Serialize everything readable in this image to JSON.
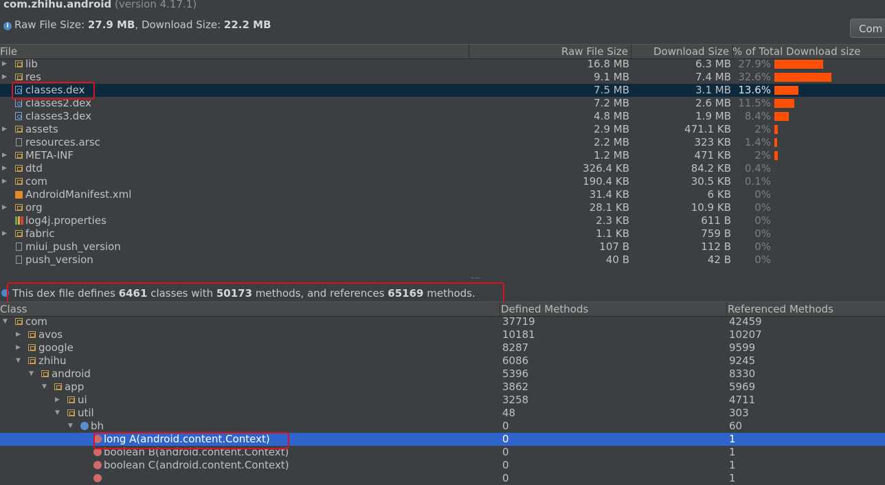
{
  "header": {
    "package": "com.zhihu.android",
    "version": "(version 4.17.1)",
    "raw_label": "Raw File Size:",
    "raw_value": "27.9 MB",
    "dl_label": ", Download Size:",
    "dl_value": "22.2 MB",
    "compare_button": "Com"
  },
  "file_table": {
    "columns": [
      "File",
      "Raw File Size",
      "Download Size",
      "% of Total Download size"
    ],
    "rows": [
      {
        "name": "lib",
        "icon": "folder-icon",
        "expandable": true,
        "raw": "16.8 MB",
        "dl": "6.3 MB",
        "pct": "27.9%",
        "share": 27.9
      },
      {
        "name": "res",
        "icon": "folder-icon",
        "expandable": true,
        "raw": "9.1 MB",
        "dl": "7.4 MB",
        "pct": "32.6%",
        "share": 32.6
      },
      {
        "name": "classes.dex",
        "icon": "dex-file-icon",
        "expandable": false,
        "raw": "7.5 MB",
        "dl": "3.1 MB",
        "pct": "13.6%",
        "share": 13.6,
        "selected": true
      },
      {
        "name": "classes2.dex",
        "icon": "dex-file-icon",
        "expandable": false,
        "raw": "7.2 MB",
        "dl": "2.6 MB",
        "pct": "11.5%",
        "share": 11.5
      },
      {
        "name": "classes3.dex",
        "icon": "dex-file-icon",
        "expandable": false,
        "raw": "4.8 MB",
        "dl": "1.9 MB",
        "pct": "8.4%",
        "share": 8.4
      },
      {
        "name": "assets",
        "icon": "folder-icon",
        "expandable": true,
        "raw": "2.9 MB",
        "dl": "471.1 KB",
        "pct": "2%",
        "share": 2
      },
      {
        "name": "resources.arsc",
        "icon": "file-icon",
        "expandable": false,
        "raw": "2.2 MB",
        "dl": "323 KB",
        "pct": "1.4%",
        "share": 1.4
      },
      {
        "name": "META-INF",
        "icon": "folder-icon",
        "expandable": true,
        "raw": "1.2 MB",
        "dl": "471 KB",
        "pct": "2%",
        "share": 2
      },
      {
        "name": "dtd",
        "icon": "folder-icon",
        "expandable": true,
        "raw": "326.4 KB",
        "dl": "84.2 KB",
        "pct": "0.4%",
        "share": 0
      },
      {
        "name": "com",
        "icon": "folder-icon",
        "expandable": true,
        "raw": "190.4 KB",
        "dl": "30.5 KB",
        "pct": "0.1%",
        "share": 0
      },
      {
        "name": "AndroidManifest.xml",
        "icon": "xml-file-icon",
        "expandable": false,
        "raw": "31.4 KB",
        "dl": "6 KB",
        "pct": "0%",
        "share": 0
      },
      {
        "name": "org",
        "icon": "folder-icon",
        "expandable": true,
        "raw": "28.1 KB",
        "dl": "10.9 KB",
        "pct": "0%",
        "share": 0
      },
      {
        "name": "log4j.properties",
        "icon": "properties-file-icon",
        "expandable": false,
        "raw": "2.3 KB",
        "dl": "611 B",
        "pct": "0%",
        "share": 0
      },
      {
        "name": "fabric",
        "icon": "folder-icon",
        "expandable": true,
        "raw": "1.1 KB",
        "dl": "759 B",
        "pct": "0%",
        "share": 0
      },
      {
        "name": "miui_push_version",
        "icon": "file-icon",
        "expandable": false,
        "raw": "107 B",
        "dl": "112 B",
        "pct": "0%",
        "share": 0
      },
      {
        "name": "push_version",
        "icon": "file-icon",
        "expandable": false,
        "raw": "40 B",
        "dl": "42 B",
        "pct": "0%",
        "share": 0
      }
    ]
  },
  "summary": {
    "t1": "This dex file defines ",
    "classes": "6461",
    "t2": " classes with ",
    "methods": "50173",
    "t3": " methods, and references ",
    "refs": "65169",
    "t4": " methods."
  },
  "class_table": {
    "columns": [
      "Class",
      "Defined Methods",
      "Referenced Methods"
    ],
    "rows": [
      {
        "name": "com",
        "kind": "package",
        "depth": 0,
        "state": "expanded",
        "def": "37719",
        "ref": "42459"
      },
      {
        "name": "avos",
        "kind": "package",
        "depth": 1,
        "state": "collapsed",
        "def": "10181",
        "ref": "10207"
      },
      {
        "name": "google",
        "kind": "package",
        "depth": 1,
        "state": "collapsed",
        "def": "8287",
        "ref": "9599"
      },
      {
        "name": "zhihu",
        "kind": "package",
        "depth": 1,
        "state": "expanded",
        "def": "6086",
        "ref": "9245"
      },
      {
        "name": "android",
        "kind": "package",
        "depth": 2,
        "state": "expanded",
        "def": "5396",
        "ref": "8330"
      },
      {
        "name": "app",
        "kind": "package",
        "depth": 3,
        "state": "expanded",
        "def": "3862",
        "ref": "5969"
      },
      {
        "name": "ui",
        "kind": "package",
        "depth": 4,
        "state": "collapsed",
        "def": "3258",
        "ref": "4711"
      },
      {
        "name": "util",
        "kind": "package",
        "depth": 4,
        "state": "expanded",
        "def": "48",
        "ref": "303"
      },
      {
        "name": "bh",
        "kind": "class",
        "depth": 5,
        "state": "expanded",
        "def": "0",
        "ref": "60"
      },
      {
        "name": "long A(android.content.Context)",
        "kind": "method",
        "depth": 6,
        "state": "leaf",
        "def": "0",
        "ref": "1",
        "selected": true
      },
      {
        "name": "boolean B(android.content.Context)",
        "kind": "method",
        "depth": 6,
        "state": "leaf",
        "def": "0",
        "ref": "1"
      },
      {
        "name": "boolean C(android.content.Context)",
        "kind": "method",
        "depth": 6,
        "state": "leaf",
        "def": "0",
        "ref": "1"
      },
      {
        "name": "",
        "kind": "method",
        "depth": 6,
        "state": "leaf",
        "def": "0",
        "ref": "1"
      }
    ]
  },
  "colors": {
    "bar": "#ff5008",
    "selection_file": "#0d293e",
    "selection_class": "#2f65ca",
    "highlight_box": "#e01020"
  }
}
